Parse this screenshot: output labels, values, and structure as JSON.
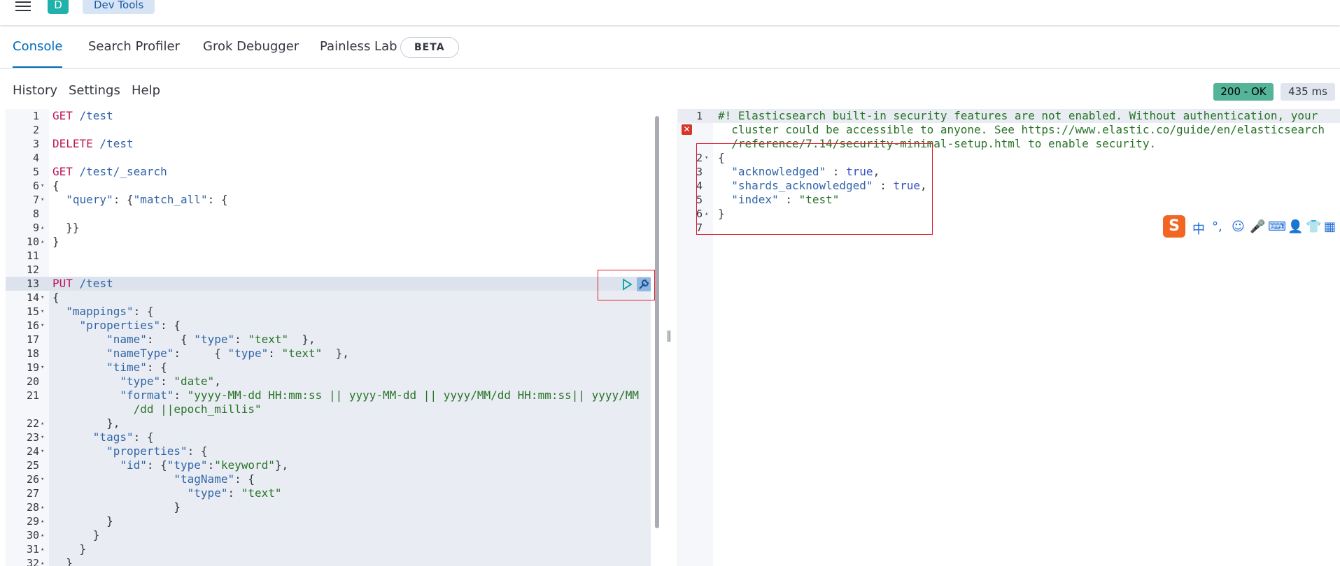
{
  "header": {
    "avatar_letter": "D",
    "breadcrumb": "Dev Tools"
  },
  "tabs": [
    {
      "label": "Console",
      "active": true
    },
    {
      "label": "Search Profiler",
      "active": false
    },
    {
      "label": "Grok Debugger",
      "active": false
    },
    {
      "label": "Painless Lab",
      "active": false
    }
  ],
  "beta_badge": "BETA",
  "menu": {
    "history": "History",
    "settings": "Settings",
    "help": "Help"
  },
  "status": {
    "code": "200 - OK",
    "time": "435 ms"
  },
  "request_editor": {
    "lines": [
      {
        "n": "1",
        "parts": [
          [
            "method",
            "GET"
          ],
          [
            "url",
            " /test"
          ]
        ]
      },
      {
        "n": "2",
        "parts": []
      },
      {
        "n": "3",
        "parts": [
          [
            "method",
            "DELETE"
          ],
          [
            "url",
            " /test"
          ]
        ]
      },
      {
        "n": "4",
        "parts": []
      },
      {
        "n": "5",
        "parts": [
          [
            "method",
            "GET"
          ],
          [
            "url",
            " /test/_search"
          ]
        ]
      },
      {
        "n": "6",
        "fold": "down",
        "parts": [
          [
            "plain",
            "{"
          ]
        ]
      },
      {
        "n": "7",
        "fold": "down",
        "parts": [
          [
            "plain",
            "  "
          ],
          [
            "key",
            "\"query\""
          ],
          [
            "plain",
            ": {"
          ],
          [
            "key",
            "\"match_all\""
          ],
          [
            "plain",
            ": {"
          ]
        ]
      },
      {
        "n": "8",
        "parts": []
      },
      {
        "n": "9",
        "fold": "up",
        "parts": [
          [
            "plain",
            "  }}"
          ]
        ]
      },
      {
        "n": "10",
        "fold": "up",
        "parts": [
          [
            "plain",
            "}"
          ]
        ]
      },
      {
        "n": "11",
        "parts": []
      },
      {
        "n": "12",
        "parts": []
      },
      {
        "n": "13",
        "parts": [
          [
            "method",
            "PUT"
          ],
          [
            "url",
            " /test"
          ]
        ]
      },
      {
        "n": "14",
        "fold": "down",
        "parts": [
          [
            "plain",
            "{"
          ]
        ]
      },
      {
        "n": "15",
        "fold": "down",
        "parts": [
          [
            "plain",
            "  "
          ],
          [
            "key",
            "\"mappings\""
          ],
          [
            "plain",
            ": {"
          ]
        ]
      },
      {
        "n": "16",
        "fold": "down",
        "parts": [
          [
            "plain",
            "    "
          ],
          [
            "key",
            "\"properties\""
          ],
          [
            "plain",
            ": {"
          ]
        ]
      },
      {
        "n": "17",
        "parts": [
          [
            "plain",
            "        "
          ],
          [
            "key",
            "\"name\""
          ],
          [
            "plain",
            ":    { "
          ],
          [
            "key",
            "\"type\""
          ],
          [
            "plain",
            ": "
          ],
          [
            "str",
            "\"text\""
          ],
          [
            "plain",
            "  },"
          ]
        ]
      },
      {
        "n": "18",
        "parts": [
          [
            "plain",
            "        "
          ],
          [
            "key",
            "\"nameType\""
          ],
          [
            "plain",
            ":     { "
          ],
          [
            "key",
            "\"type\""
          ],
          [
            "plain",
            ": "
          ],
          [
            "str",
            "\"text\""
          ],
          [
            "plain",
            "  },"
          ]
        ]
      },
      {
        "n": "19",
        "fold": "down",
        "parts": [
          [
            "plain",
            "        "
          ],
          [
            "key",
            "\"time\""
          ],
          [
            "plain",
            ": {"
          ]
        ]
      },
      {
        "n": "20",
        "parts": [
          [
            "plain",
            "          "
          ],
          [
            "key",
            "\"type\""
          ],
          [
            "plain",
            ": "
          ],
          [
            "str",
            "\"date\""
          ],
          [
            "plain",
            ","
          ]
        ]
      },
      {
        "n": "21",
        "parts": [
          [
            "plain",
            "          "
          ],
          [
            "key",
            "\"format\""
          ],
          [
            "plain",
            ": "
          ],
          [
            "str",
            "\"yyyy-MM-dd HH:mm:ss || yyyy-MM-dd || yyyy/MM/dd HH:mm:ss|| yyyy/MM"
          ]
        ]
      },
      {
        "n": "",
        "parts": [
          [
            "plain",
            "            "
          ],
          [
            "str",
            "/dd ||epoch_millis\""
          ]
        ]
      },
      {
        "n": "22",
        "fold": "up",
        "parts": [
          [
            "plain",
            "        },"
          ]
        ]
      },
      {
        "n": "23",
        "fold": "down",
        "parts": [
          [
            "plain",
            "      "
          ],
          [
            "key",
            "\"tags\""
          ],
          [
            "plain",
            ": {"
          ]
        ]
      },
      {
        "n": "24",
        "fold": "down",
        "parts": [
          [
            "plain",
            "        "
          ],
          [
            "key",
            "\"properties\""
          ],
          [
            "plain",
            ": {"
          ]
        ]
      },
      {
        "n": "25",
        "parts": [
          [
            "plain",
            "          "
          ],
          [
            "key",
            "\"id\""
          ],
          [
            "plain",
            ": {"
          ],
          [
            "key",
            "\"type\""
          ],
          [
            "plain",
            ":"
          ],
          [
            "str",
            "\"keyword\""
          ],
          [
            "plain",
            "},"
          ]
        ]
      },
      {
        "n": "26",
        "fold": "down",
        "parts": [
          [
            "plain",
            "                  "
          ],
          [
            "key",
            "\"tagName\""
          ],
          [
            "plain",
            ": {"
          ]
        ]
      },
      {
        "n": "27",
        "parts": [
          [
            "plain",
            "                    "
          ],
          [
            "key",
            "\"type\""
          ],
          [
            "plain",
            ": "
          ],
          [
            "str",
            "\"text\""
          ]
        ]
      },
      {
        "n": "28",
        "fold": "up",
        "parts": [
          [
            "plain",
            "                  }"
          ]
        ]
      },
      {
        "n": "29",
        "fold": "up",
        "parts": [
          [
            "plain",
            "        }"
          ]
        ]
      },
      {
        "n": "30",
        "fold": "up",
        "parts": [
          [
            "plain",
            "      }"
          ]
        ]
      },
      {
        "n": "31",
        "fold": "up",
        "parts": [
          [
            "plain",
            "    }"
          ]
        ]
      },
      {
        "n": "32",
        "fold": "up",
        "parts": [
          [
            "plain",
            "  }"
          ]
        ]
      }
    ]
  },
  "response_editor": {
    "lines": [
      {
        "n": "1",
        "parts": [
          [
            "comment",
            "#! Elasticsearch built-in security features are not enabled. Without authentication, your"
          ]
        ]
      },
      {
        "n": "",
        "parts": [
          [
            "comment",
            "  cluster could be accessible to anyone. See https://www.elastic.co/guide/en/elasticsearch"
          ]
        ]
      },
      {
        "n": "",
        "parts": [
          [
            "comment",
            "  /reference/7.14/security-minimal-setup.html to enable security."
          ]
        ]
      },
      {
        "n": "2",
        "fold": "down",
        "parts": [
          [
            "plain",
            "{"
          ]
        ]
      },
      {
        "n": "3",
        "parts": [
          [
            "plain",
            "  "
          ],
          [
            "key",
            "\"acknowledged\""
          ],
          [
            "plain",
            " : "
          ],
          [
            "bool",
            "true"
          ],
          [
            "plain",
            ","
          ]
        ]
      },
      {
        "n": "4",
        "parts": [
          [
            "plain",
            "  "
          ],
          [
            "key",
            "\"shards_acknowledged\""
          ],
          [
            "plain",
            " : "
          ],
          [
            "bool",
            "true"
          ],
          [
            "plain",
            ","
          ]
        ]
      },
      {
        "n": "5",
        "parts": [
          [
            "plain",
            "  "
          ],
          [
            "key",
            "\"index\""
          ],
          [
            "plain",
            " : "
          ],
          [
            "str",
            "\"test\""
          ]
        ]
      },
      {
        "n": "6",
        "fold": "up",
        "parts": [
          [
            "plain",
            "}"
          ]
        ]
      },
      {
        "n": "7",
        "parts": []
      }
    ]
  },
  "ime_toolbar": {
    "logo": "S",
    "items": [
      "中",
      "°,",
      "☺",
      "🎤",
      "⌨",
      "👤",
      "👕",
      "▦"
    ]
  }
}
